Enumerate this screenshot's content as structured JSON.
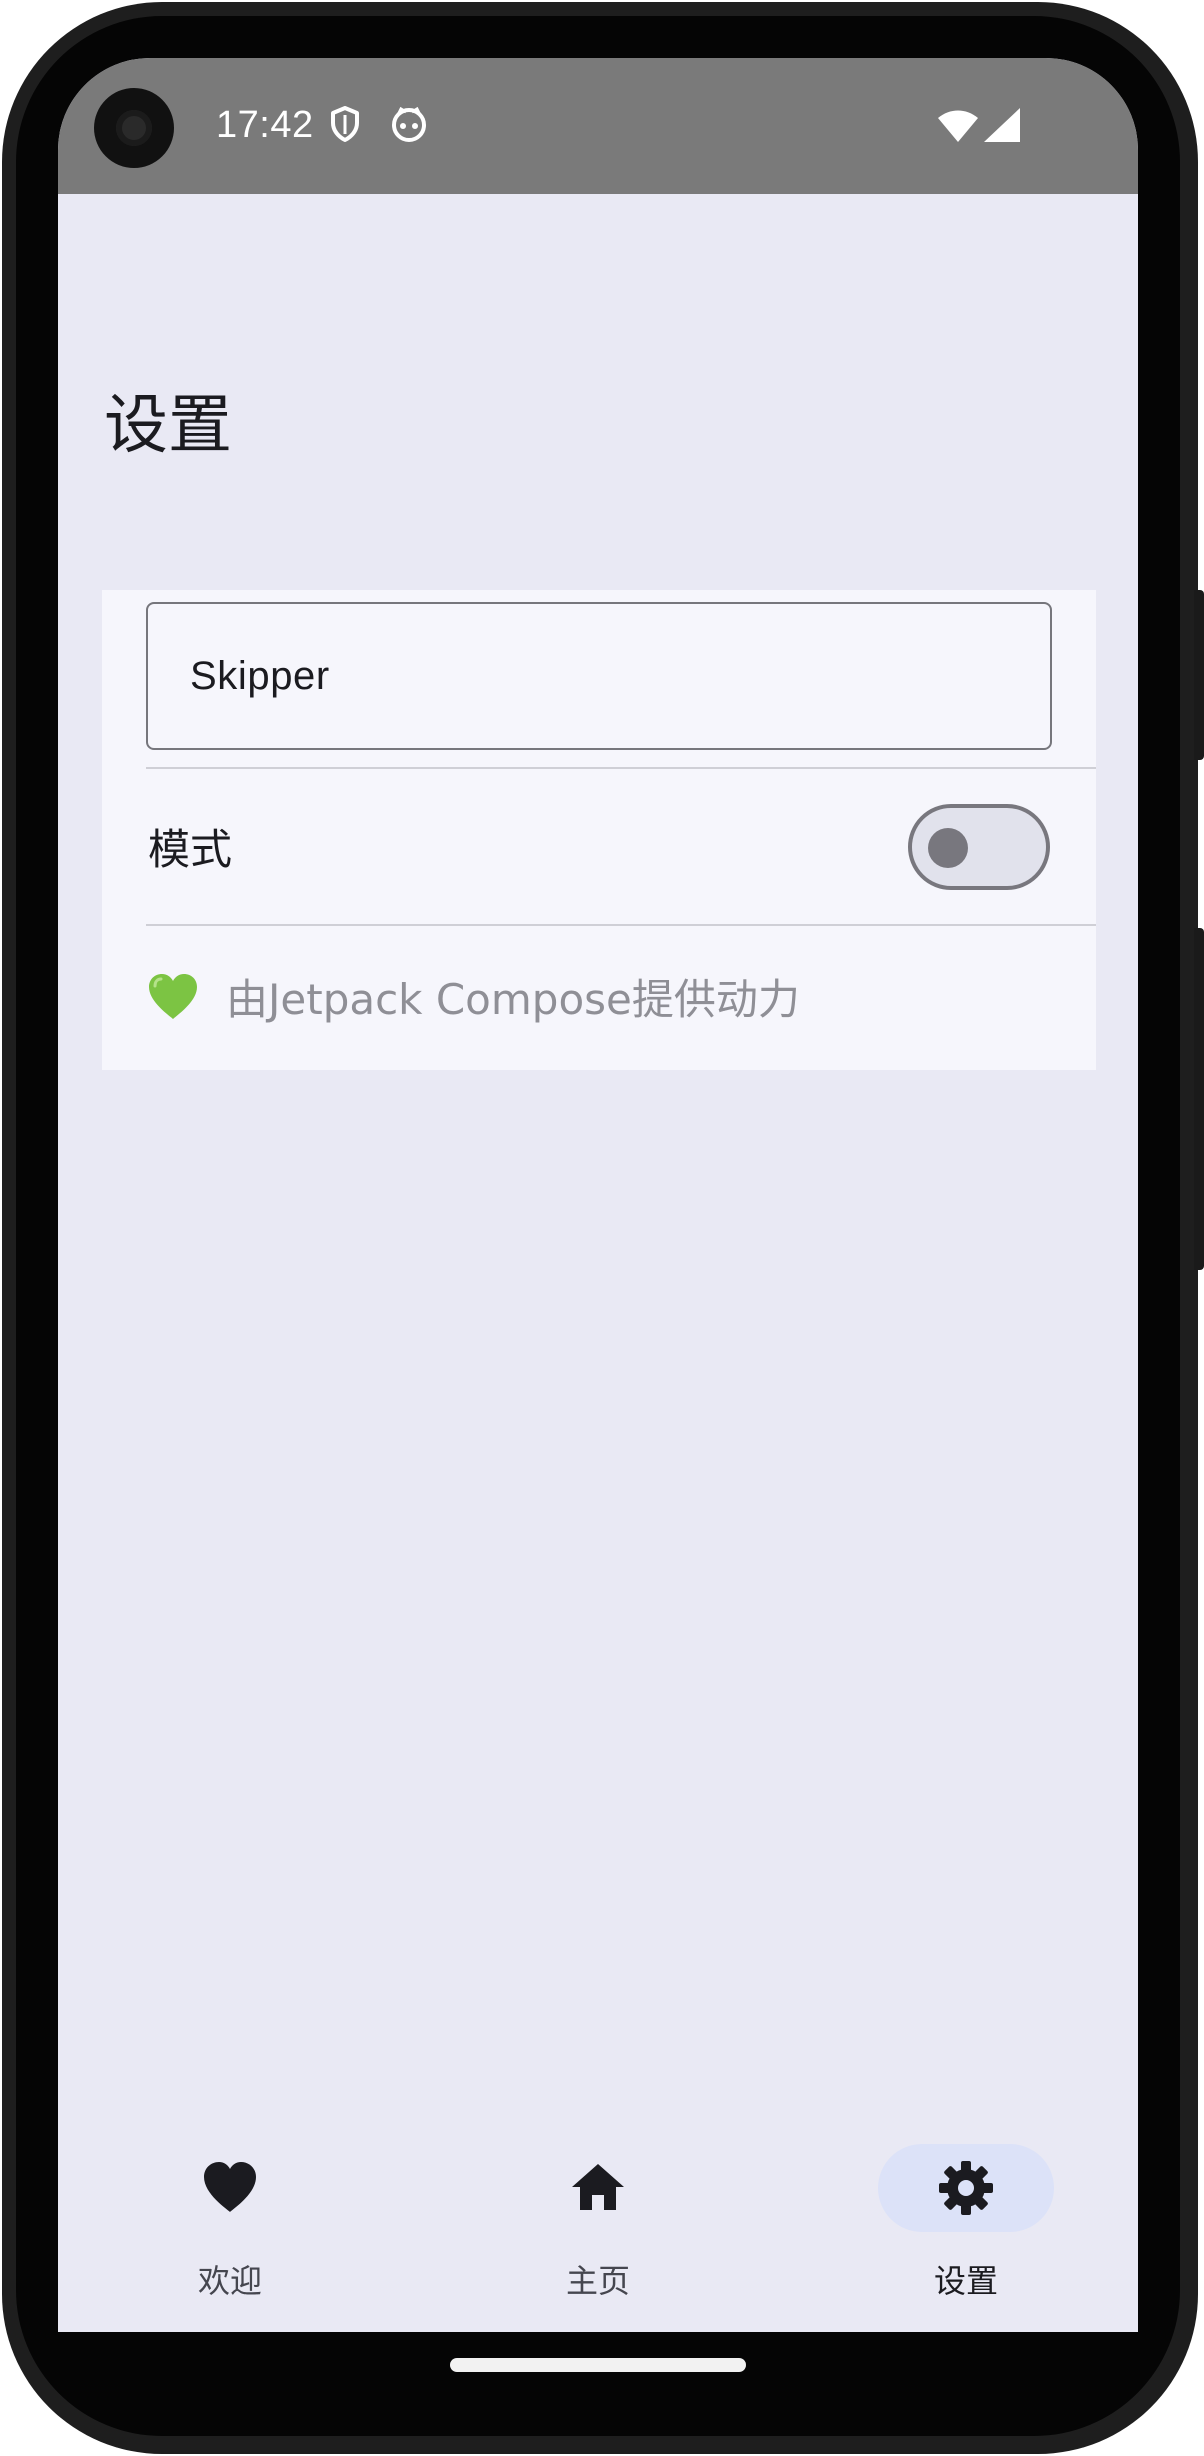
{
  "status_bar": {
    "time": "17:42",
    "icons": [
      "shield-icon",
      "cat-icon",
      "wifi-icon",
      "signal-icon"
    ]
  },
  "page": {
    "title": "设置"
  },
  "settings": {
    "name_field": {
      "value": "Skipper",
      "placeholder": ""
    },
    "mode_row": {
      "label": "模式",
      "toggle_on": false
    },
    "footer_note": {
      "emoji_icon": "green-heart-icon",
      "text": "由Jetpack Compose提供动力"
    }
  },
  "bottom_nav": {
    "items": [
      {
        "label": "欢迎",
        "icon": "heart-icon",
        "active": false
      },
      {
        "label": "主页",
        "icon": "home-icon",
        "active": false
      },
      {
        "label": "设置",
        "icon": "gear-icon",
        "active": true
      }
    ]
  },
  "colors": {
    "background": "#e9e9f4",
    "card": "#f6f6fc",
    "status_bar": "#7a7a7a",
    "nav_active_pill": "#dce2f8",
    "text_primary": "#1b1b20",
    "text_muted": "#8f8f96",
    "heart_green": "#7cc443"
  }
}
